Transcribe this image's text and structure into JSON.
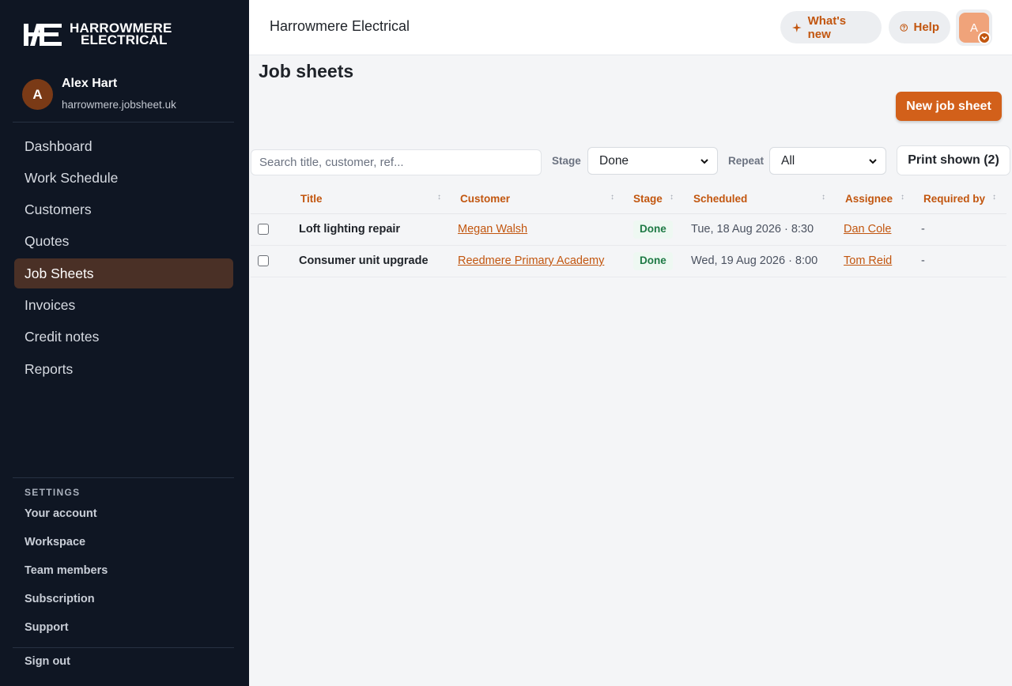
{
  "brand": {
    "logo_mark": "HE",
    "logo_line1": "HARROWMERE",
    "logo_line2": "ELECTRICAL",
    "accent": "#d2601a",
    "sidebar_bg": "#0f1623"
  },
  "user": {
    "initial": "A",
    "name": "Alex Hart",
    "site": "harrowmere.jobsheet.uk"
  },
  "nav": {
    "items": [
      {
        "label": "Dashboard"
      },
      {
        "label": "Work Schedule"
      },
      {
        "label": "Customers"
      },
      {
        "label": "Quotes"
      },
      {
        "label": "Job Sheets",
        "active": true
      },
      {
        "label": "Invoices"
      },
      {
        "label": "Credit notes"
      },
      {
        "label": "Reports"
      }
    ]
  },
  "settings": {
    "heading": "SETTINGS",
    "items": [
      "Your account",
      "Workspace",
      "Team members",
      "Subscription",
      "Support"
    ],
    "sign_out": "Sign out"
  },
  "topbar": {
    "company": "Harrowmere Electrical",
    "whats_new": "What's new",
    "help": "Help",
    "avatar_initial": "A"
  },
  "page": {
    "title": "Job sheets",
    "new_button": "New job sheet"
  },
  "filters": {
    "search_placeholder": "Search title, customer, ref...",
    "stage_label": "Stage",
    "stage_value": "Done",
    "repeat_label": "Repeat",
    "repeat_value": "All",
    "print_button": "Print shown (2)"
  },
  "table": {
    "headers": {
      "title": "Title",
      "customer": "Customer",
      "stage": "Stage",
      "scheduled": "Scheduled",
      "assignee": "Assignee",
      "required_by": "Required by"
    },
    "rows": [
      {
        "title": "Loft lighting repair",
        "customer": "Megan Walsh",
        "stage": "Done",
        "scheduled": "Tue, 18 Aug 2026 · 8:30",
        "assignee": "Dan Cole",
        "required_by": "-"
      },
      {
        "title": "Consumer unit upgrade",
        "customer": "Reedmere Primary Academy",
        "stage": "Done",
        "scheduled": "Wed, 19 Aug 2026 · 8:00",
        "assignee": "Tom Reid",
        "required_by": "-"
      }
    ]
  }
}
